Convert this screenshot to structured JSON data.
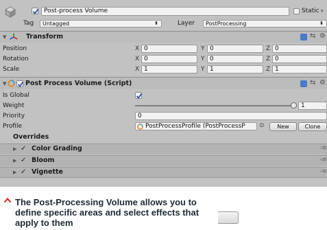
{
  "header": {
    "object_name": "Post-process Volume",
    "static_label": "Static",
    "tag_label": "Tag",
    "tag_value": "Untagged",
    "layer_label": "Layer",
    "layer_value": "PostProcessing"
  },
  "transform": {
    "title": "Transform",
    "rows": [
      {
        "label": "Position",
        "x": "0",
        "y": "0",
        "z": "0"
      },
      {
        "label": "Rotation",
        "x": "0",
        "y": "0",
        "z": "0"
      },
      {
        "label": "Scale",
        "x": "1",
        "y": "1",
        "z": "1"
      }
    ],
    "axis_x": "X",
    "axis_y": "Y",
    "axis_z": "Z"
  },
  "volume": {
    "title": "Post Process Volume (Script)",
    "is_global_label": "Is Global",
    "is_global": true,
    "weight_label": "Weight",
    "weight_value": "1",
    "weight_fraction": 1.0,
    "priority_label": "Priority",
    "priority_value": "0",
    "profile_label": "Profile",
    "profile_value": "PostProcessProfile (PostProcessP",
    "new_button": "New",
    "clone_button": "Clone",
    "overrides_label": "Overrides",
    "overrides": [
      {
        "label": "Color Grading",
        "enabled": true
      },
      {
        "label": "Bloom",
        "enabled": true
      },
      {
        "label": "Vignette",
        "enabled": true
      }
    ]
  },
  "caption": {
    "text": "The Post-Processing Volume allows you to define specific areas and select effects that apply to them"
  },
  "colors": {
    "inspector_bg": "#c2c2c2",
    "caption_accent": "#d9342b",
    "caption_text": "#1f2a35"
  }
}
